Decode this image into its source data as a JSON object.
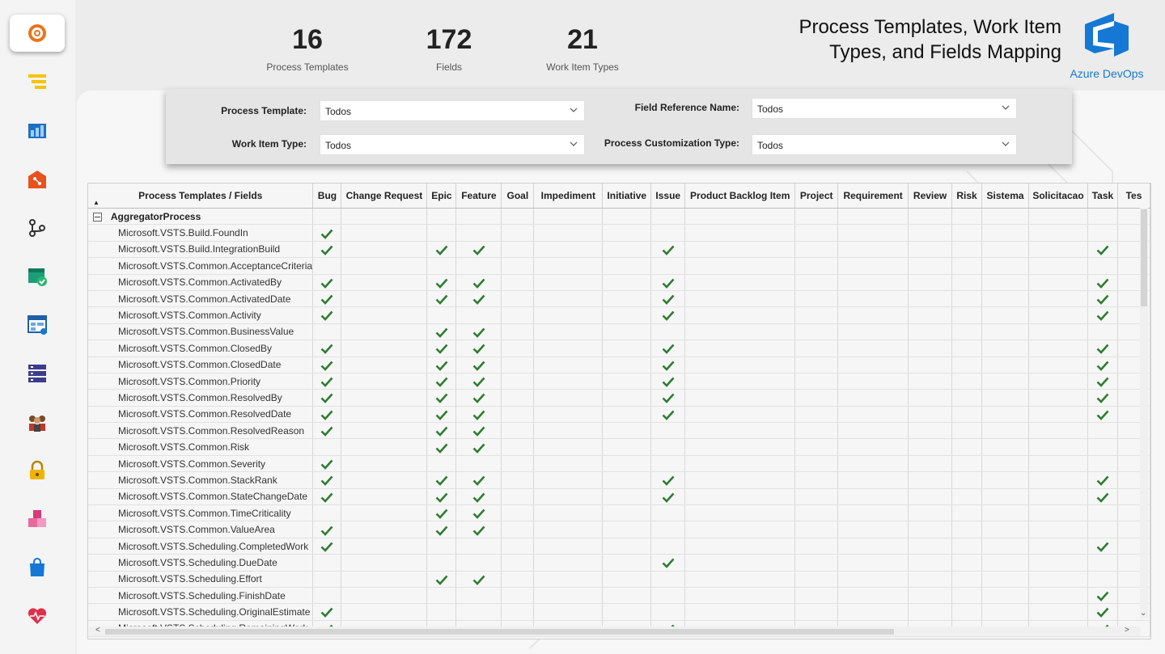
{
  "kpis": [
    {
      "value": "16",
      "label": "Process Templates"
    },
    {
      "value": "172",
      "label": "Fields"
    },
    {
      "value": "21",
      "label": "Work Item Types"
    }
  ],
  "title": "Process Templates, Work Item Types, and Fields Mapping",
  "logo_text": "Azure DevOps",
  "sidebar_icons": [
    "azure-devops-gear-icon",
    "boards-icon",
    "backlog-icon",
    "repos-icon",
    "pull-request-icon",
    "test-plans-icon",
    "dashboard-icon",
    "pipelines-icon",
    "teams-icon",
    "security-lock-icon",
    "artifacts-icon",
    "marketplace-bag-icon",
    "health-heart-icon"
  ],
  "filters": {
    "process_template": {
      "label": "Process Template:",
      "value": "Todos"
    },
    "work_item_type": {
      "label": "Work Item Type:",
      "value": "Todos"
    },
    "field_reference_name": {
      "label": "Field Reference Name:",
      "value": "Todos"
    },
    "process_customization_type": {
      "label": "Process Customization Type:",
      "value": "Todos"
    }
  },
  "matrix": {
    "row_header": "Process Templates / Fields",
    "columns": [
      "Bug",
      "Change Request",
      "Epic",
      "Feature",
      "Goal",
      "Impediment",
      "Initiative",
      "Issue",
      "Product Backlog Item",
      "Project",
      "Requirement",
      "Review",
      "Risk",
      "Sistema",
      "Solicitacao",
      "Task",
      "Tes"
    ],
    "group": "AggregatorProcess",
    "rows": [
      {
        "field": "Microsoft.VSTS.Build.FoundIn",
        "checks": [
          "Bug"
        ]
      },
      {
        "field": "Microsoft.VSTS.Build.IntegrationBuild",
        "checks": [
          "Bug",
          "Epic",
          "Feature",
          "Issue",
          "Task"
        ]
      },
      {
        "field": "Microsoft.VSTS.Common.AcceptanceCriteria",
        "checks": []
      },
      {
        "field": "Microsoft.VSTS.Common.ActivatedBy",
        "checks": [
          "Bug",
          "Epic",
          "Feature",
          "Issue",
          "Task"
        ]
      },
      {
        "field": "Microsoft.VSTS.Common.ActivatedDate",
        "checks": [
          "Bug",
          "Epic",
          "Feature",
          "Issue",
          "Task"
        ]
      },
      {
        "field": "Microsoft.VSTS.Common.Activity",
        "checks": [
          "Bug",
          "Issue",
          "Task"
        ]
      },
      {
        "field": "Microsoft.VSTS.Common.BusinessValue",
        "checks": [
          "Epic",
          "Feature"
        ]
      },
      {
        "field": "Microsoft.VSTS.Common.ClosedBy",
        "checks": [
          "Bug",
          "Epic",
          "Feature",
          "Issue",
          "Task"
        ]
      },
      {
        "field": "Microsoft.VSTS.Common.ClosedDate",
        "checks": [
          "Bug",
          "Epic",
          "Feature",
          "Issue",
          "Task"
        ]
      },
      {
        "field": "Microsoft.VSTS.Common.Priority",
        "checks": [
          "Bug",
          "Epic",
          "Feature",
          "Issue",
          "Task"
        ]
      },
      {
        "field": "Microsoft.VSTS.Common.ResolvedBy",
        "checks": [
          "Bug",
          "Epic",
          "Feature",
          "Issue",
          "Task"
        ]
      },
      {
        "field": "Microsoft.VSTS.Common.ResolvedDate",
        "checks": [
          "Bug",
          "Epic",
          "Feature",
          "Issue",
          "Task"
        ]
      },
      {
        "field": "Microsoft.VSTS.Common.ResolvedReason",
        "checks": [
          "Bug",
          "Epic",
          "Feature"
        ]
      },
      {
        "field": "Microsoft.VSTS.Common.Risk",
        "checks": [
          "Epic",
          "Feature"
        ]
      },
      {
        "field": "Microsoft.VSTS.Common.Severity",
        "checks": [
          "Bug"
        ]
      },
      {
        "field": "Microsoft.VSTS.Common.StackRank",
        "checks": [
          "Bug",
          "Epic",
          "Feature",
          "Issue",
          "Task"
        ]
      },
      {
        "field": "Microsoft.VSTS.Common.StateChangeDate",
        "checks": [
          "Bug",
          "Epic",
          "Feature",
          "Issue",
          "Task"
        ]
      },
      {
        "field": "Microsoft.VSTS.Common.TimeCriticality",
        "checks": [
          "Epic",
          "Feature"
        ]
      },
      {
        "field": "Microsoft.VSTS.Common.ValueArea",
        "checks": [
          "Bug",
          "Epic",
          "Feature"
        ]
      },
      {
        "field": "Microsoft.VSTS.Scheduling.CompletedWork",
        "checks": [
          "Bug",
          "Task"
        ]
      },
      {
        "field": "Microsoft.VSTS.Scheduling.DueDate",
        "checks": [
          "Issue"
        ]
      },
      {
        "field": "Microsoft.VSTS.Scheduling.Effort",
        "checks": [
          "Epic",
          "Feature"
        ]
      },
      {
        "field": "Microsoft.VSTS.Scheduling.FinishDate",
        "checks": [
          "Task"
        ]
      },
      {
        "field": "Microsoft.VSTS.Scheduling.OriginalEstimate",
        "checks": [
          "Bug",
          "Task"
        ]
      },
      {
        "field": "Microsoft.VSTS.Scheduling.RemainingWork",
        "checks": [
          "Bug",
          "Issue",
          "Task"
        ]
      }
    ]
  },
  "colors": {
    "check": "#2e7d32",
    "accent": "#1478d4"
  }
}
